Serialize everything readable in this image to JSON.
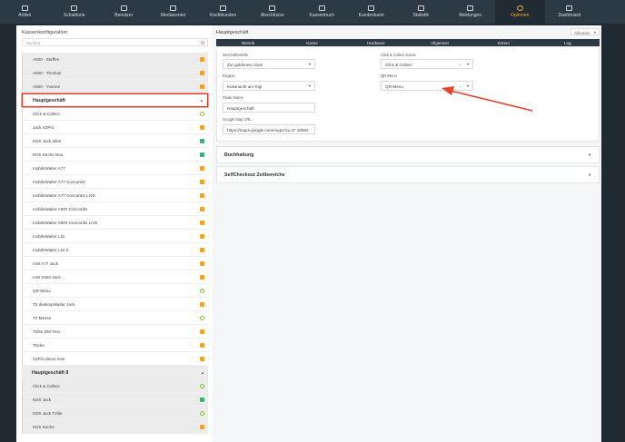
{
  "nav": [
    {
      "label": "Artikel",
      "icon": "box-icon"
    },
    {
      "label": "Schablone",
      "icon": "template-icon"
    },
    {
      "label": "Benutzer",
      "icon": "users-icon"
    },
    {
      "label": "Mediacenter",
      "icon": "media-icon"
    },
    {
      "label": "Kreditkunden",
      "icon": "credit-icon"
    },
    {
      "label": "Abschlüsse",
      "icon": "closing-icon"
    },
    {
      "label": "Kassenbuch",
      "icon": "cashbook-icon"
    },
    {
      "label": "Kundenkarte",
      "icon": "card-icon"
    },
    {
      "label": "Statistik",
      "icon": "chart-icon"
    },
    {
      "label": "Meldungen",
      "icon": "message-icon"
    },
    {
      "label": "Optionen",
      "icon": "gear-icon"
    },
    {
      "label": "Dashboard",
      "icon": "dashboard-icon"
    }
  ],
  "nav_active": "Optionen",
  "sidebar": {
    "title": "Kassenkonfiguration",
    "search_placeholder": "Suchen",
    "top_rows": [
      {
        "label": "A920 - Steffen",
        "badge": "orange"
      },
      {
        "label": "A920 - Thomas",
        "badge": "orange"
      },
      {
        "label": "A920 - Yvonne",
        "badge": "orange"
      }
    ],
    "group1": {
      "label": "Hauptgeschäft",
      "rows": [
        {
          "label": "Click & Collect",
          "badge": "ring"
        },
        {
          "label": "Jack V2Pro",
          "badge": "orange"
        },
        {
          "label": "KDS Jack t2lite",
          "badge": "green"
        },
        {
          "label": "KDS Küche Neu",
          "badge": "green"
        },
        {
          "label": "mobileWaiter A77",
          "badge": "orange"
        },
        {
          "label": "mobileWaiter A77 Concardis",
          "badge": "orange"
        },
        {
          "label": "mobileWaiter A77 Concardis LIVE",
          "badge": "orange"
        },
        {
          "label": "mobileWaiter A920 Concardis",
          "badge": "orange"
        },
        {
          "label": "mobileWaiter A920 Concardis LIVE",
          "badge": "orange"
        },
        {
          "label": "mobileWaiter L2s",
          "badge": "orange"
        },
        {
          "label": "mobileWaiter L2s II",
          "badge": "orange"
        },
        {
          "label": "mW A77 Jack",
          "badge": "orange"
        },
        {
          "label": "mW A920 Jack",
          "badge": "orange"
        },
        {
          "label": "QR-Menu",
          "badge": "ring"
        },
        {
          "label": "T2 desktopWaiter Jack",
          "badge": "orange"
        },
        {
          "label": "T2 Messe",
          "badge": "ring"
        },
        {
          "label": "T2lite DW Test",
          "badge": "orange"
        },
        {
          "label": "Theke",
          "badge": "orange"
        },
        {
          "label": "V2Pro demo new",
          "badge": "orange"
        }
      ]
    },
    "group2": {
      "label": "Hauptgeschäft II",
      "rows": [
        {
          "label": "Click & Collect",
          "badge": "ring"
        },
        {
          "label": "KDS Jack",
          "badge": "green"
        },
        {
          "label": "KDS Jack T2lite",
          "badge": "ring"
        },
        {
          "label": "KDS Küche",
          "badge": "orange"
        }
      ]
    }
  },
  "main": {
    "title": "Hauptgeschäft",
    "action_select": "Aktionen",
    "tabs": [
      "Betrieb",
      "Kasse",
      "Hardware",
      "Allgemein",
      "Extern",
      "Log"
    ],
    "fields": {
      "geschaeftsstelle_label": "Geschäftsstelle",
      "geschaeftsstelle_value": "Zur goldenen Löwn",
      "cc_kasse_label": "Click & Collect Kasse",
      "cc_kasse_value": "Click & Collect",
      "region_label": "Region",
      "region_value": "Küssnacht am Rigi",
      "qr_label": "QR-Menu",
      "qr_value": "QR-Menu",
      "filiale_label": "Filiale Name",
      "filiale_value": "Hauptgeschäft",
      "gmap_label": "Google Map URL",
      "gmap_value": "https://maps.google.com/maps?q=47.10982"
    },
    "sections": [
      "Buchhaltung",
      "SelfCheckout Zeitbereiche"
    ]
  },
  "colors": {
    "accent": "#f1a92a",
    "highlight": "#e23b2a",
    "nav_bg": "#2c3a46"
  }
}
